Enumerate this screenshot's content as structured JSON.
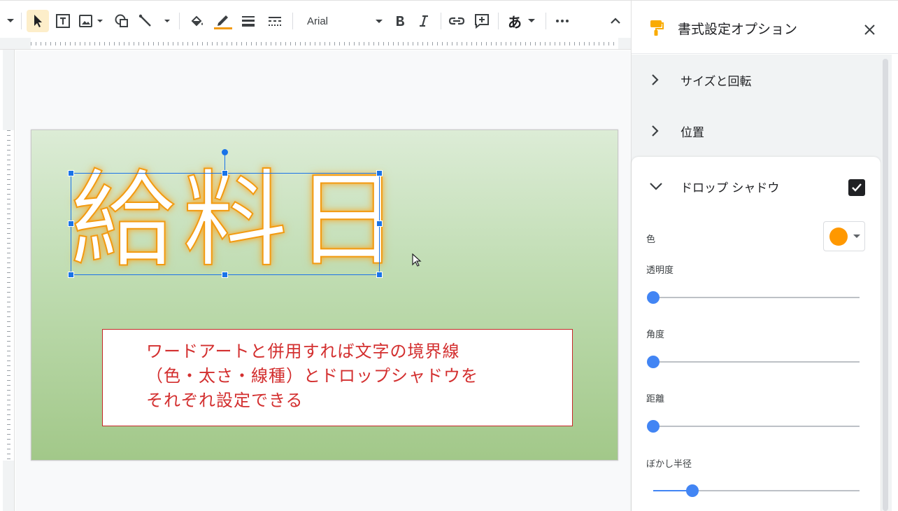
{
  "toolbar": {
    "font_name": "Arial",
    "input_tool_label": "あ",
    "accent_line_color": "#f29a10",
    "icons": [
      "dropdown-icon",
      "select-cursor-icon",
      "textbox-icon",
      "image-icon",
      "shape-icon",
      "line-icon",
      "fill-color-icon",
      "border-color-icon",
      "border-weight-icon",
      "border-dash-icon",
      "bold-icon",
      "italic-icon",
      "link-icon",
      "comment-icon",
      "more-icon",
      "collapse-icon"
    ]
  },
  "slide": {
    "wordart_text": "給料日",
    "note_lines": [
      "ワードアートと併用すれば文字の境界線",
      "（色・太さ・線種）とドロップシャドウを",
      "それぞれ設定できる"
    ],
    "wordart_stroke_color": "#f29a10",
    "note_text_color": "#d32f2f"
  },
  "sidebar": {
    "title": "書式設定オプション",
    "sections": {
      "size_rotation": "サイズと回転",
      "position": "位置",
      "drop_shadow": "ドロップ シャドウ"
    },
    "drop_shadow_enabled": true,
    "color_label": "色",
    "shadow_color": "#ff9800",
    "sliders": [
      {
        "label": "透明度",
        "value": 0
      },
      {
        "label": "角度",
        "value": 0
      },
      {
        "label": "距離",
        "value": 0
      },
      {
        "label": "ぼかし半径",
        "value": 0.19
      }
    ]
  }
}
